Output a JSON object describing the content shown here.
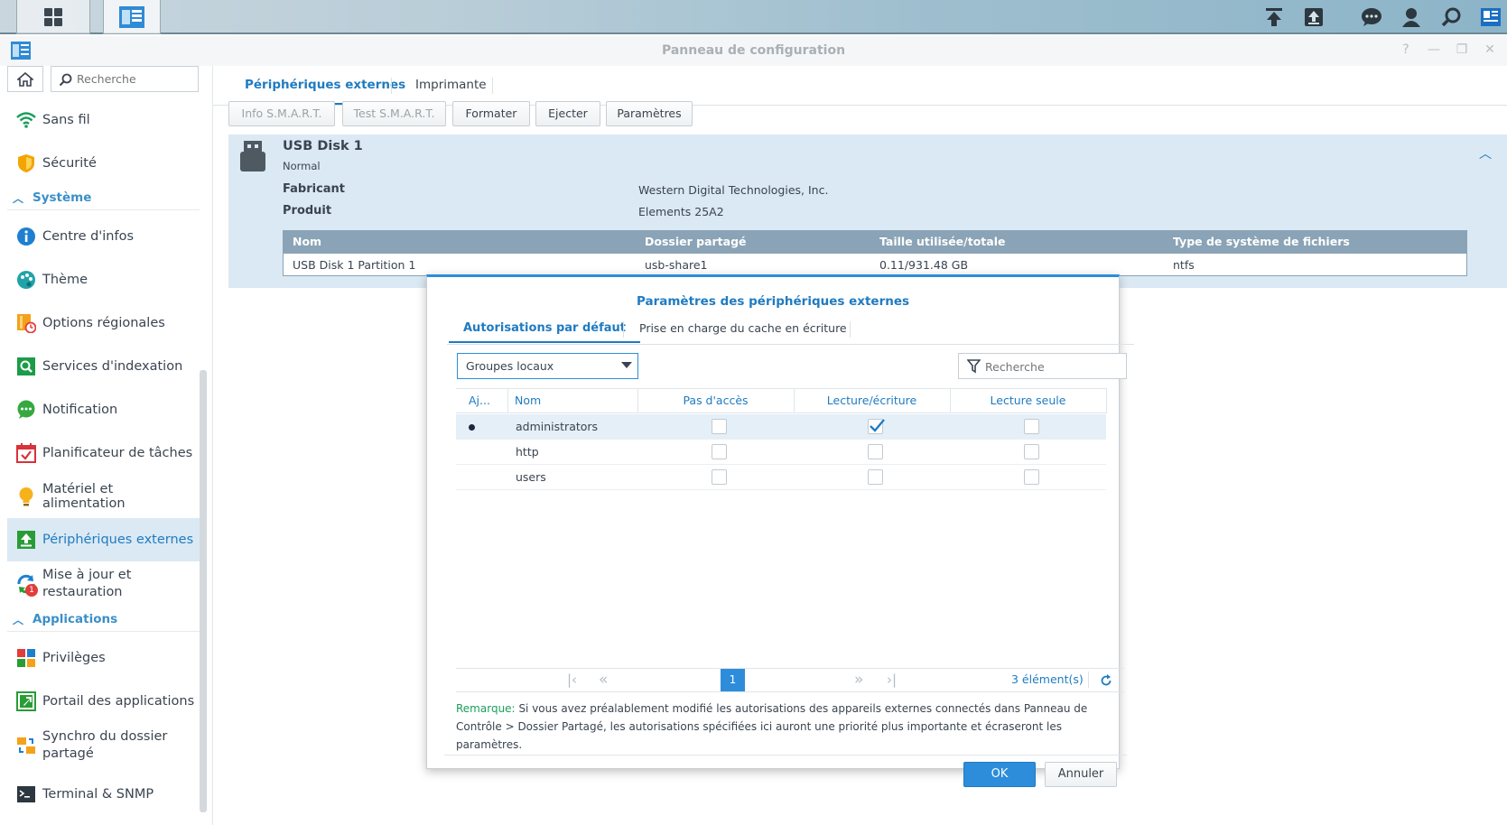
{
  "window": {
    "title": "Panneau de configuration"
  },
  "sidebar": {
    "search_placeholder": "Recherche",
    "items": [
      {
        "label": "Sans fil",
        "icon": "wifi-icon"
      },
      {
        "label": "Sécurité",
        "icon": "shield-icon"
      },
      {
        "label": "Centre d'infos",
        "icon": "info-icon"
      },
      {
        "label": "Thème",
        "icon": "palette-icon"
      },
      {
        "label": "Options régionales",
        "icon": "regional-icon"
      },
      {
        "label": "Services d'indexation",
        "icon": "index-search-icon"
      },
      {
        "label": "Notification",
        "icon": "chat-bubble-icon"
      },
      {
        "label": "Planificateur de tâches",
        "icon": "calendar-check-icon"
      },
      {
        "label": "Matériel et alimentation",
        "icon": "lightbulb-icon"
      },
      {
        "label": "Périphériques externes",
        "icon": "upload-icon"
      },
      {
        "label_line1": "Mise à jour et",
        "label_line2": "restauration",
        "icon": "update-icon",
        "badge": "1"
      },
      {
        "label": "Privilèges",
        "icon": "grid-icon"
      },
      {
        "label": "Portail des applications",
        "icon": "portal-icon"
      },
      {
        "label_line1": "Synchro du dossier",
        "label_line2": "partagé",
        "icon": "folder-sync-icon"
      },
      {
        "label": "Terminal & SNMP",
        "icon": "terminal-icon"
      }
    ],
    "section_system": "Système",
    "section_apps": "Applications"
  },
  "main": {
    "tabs": [
      "Périphériques externes",
      "Imprimante"
    ],
    "toolbar": [
      "Info S.M.A.R.T.",
      "Test S.M.A.R.T.",
      "Formater",
      "Ejecter",
      "Paramètres"
    ],
    "device": {
      "name": "USB Disk 1",
      "status": "Normal",
      "manufacturer_label": "Fabricant",
      "manufacturer": "Western Digital Technologies, Inc.",
      "product_label": "Produit",
      "product": "Elements 25A2"
    },
    "partition_table": {
      "headers": [
        "Nom",
        "Dossier partagé",
        "Taille utilisée/totale",
        "Type de système de fichiers"
      ],
      "rows": [
        [
          "USB Disk 1 Partition 1",
          "usb-share1",
          "0.11/931.48 GB",
          "ntfs"
        ]
      ]
    }
  },
  "dialog": {
    "title": "Paramètres des périphériques externes",
    "tabs": [
      "Autorisations par défaut",
      "Prise en charge du cache en écriture"
    ],
    "group_select": "Groupes locaux",
    "search_placeholder": "Recherche",
    "headers": [
      "Aj...",
      "Nom",
      "Pas d'accès",
      "Lecture/écriture",
      "Lecture seule"
    ],
    "rows": [
      {
        "name": "administrators",
        "admin": true,
        "no_access": false,
        "read_write": true,
        "read_only": false
      },
      {
        "name": "http",
        "admin": false,
        "no_access": false,
        "read_write": false,
        "read_only": false
      },
      {
        "name": "users",
        "admin": false,
        "no_access": false,
        "read_write": false,
        "read_only": false
      }
    ],
    "pagination": {
      "page": "1",
      "count": "3 élément(s)"
    },
    "note_label": "Remarque:",
    "note_line1": "Si vous avez préalablement modifié les autorisations des appareils externes connectés dans Panneau de",
    "note_line2": "Contrôle > Dossier Partagé, les autorisations spécifiées ici auront une priorité plus importante et écraseront les",
    "note_line3": "paramètres.",
    "ok": "OK",
    "cancel": "Annuler"
  },
  "colors": {
    "accent": "#2d8ddb",
    "header_blue": "#1f7bc1",
    "table_header_bg": "#8aa3b6",
    "selected_bg": "#dbe9f4"
  }
}
